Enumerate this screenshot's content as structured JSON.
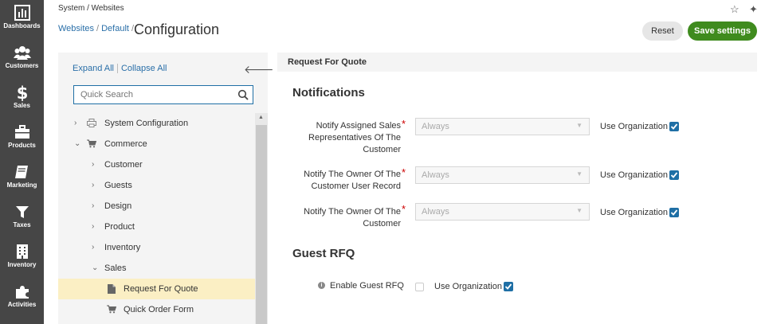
{
  "nav": {
    "items": [
      {
        "label": "Dashboards",
        "icon": "dashboard-icon"
      },
      {
        "label": "Customers",
        "icon": "users-icon"
      },
      {
        "label": "Sales",
        "icon": "dollar-icon"
      },
      {
        "label": "Products",
        "icon": "briefcase-icon"
      },
      {
        "label": "Marketing",
        "icon": "book-icon"
      },
      {
        "label": "Taxes",
        "icon": "filter-icon"
      },
      {
        "label": "Inventory",
        "icon": "building-icon"
      },
      {
        "label": "Activities",
        "icon": "puzzle-icon"
      }
    ]
  },
  "header": {
    "crumb_top": "System / Websites",
    "crumb_websites": "Websites",
    "crumb_sep": "/",
    "crumb_default": "Default",
    "title": "Configuration",
    "star_icon": "☆",
    "pin_icon": "✦",
    "reset_label": "Reset",
    "save_label": "Save settings"
  },
  "tree": {
    "expand_all": "Expand All",
    "collapse_all": "Collapse All",
    "back_arrow": "🡐",
    "search_placeholder": "Quick Search",
    "items": [
      {
        "label": "System Configuration",
        "level": 0,
        "chevron": "›",
        "icon": "printer-icon"
      },
      {
        "label": "Commerce",
        "level": 0,
        "chevron": "⌄",
        "icon": "cart-icon"
      },
      {
        "label": "Customer",
        "level": 1,
        "chevron": "›"
      },
      {
        "label": "Guests",
        "level": 1,
        "chevron": "›"
      },
      {
        "label": "Design",
        "level": 1,
        "chevron": "›"
      },
      {
        "label": "Product",
        "level": 1,
        "chevron": "›"
      },
      {
        "label": "Inventory",
        "level": 1,
        "chevron": "›"
      },
      {
        "label": "Sales",
        "level": 1,
        "chevron": "⌄"
      },
      {
        "label": "Request For Quote",
        "level": 2,
        "icon": "file-icon",
        "selected": true
      },
      {
        "label": "Quick Order Form",
        "level": 2,
        "icon": "cart-icon"
      }
    ]
  },
  "content": {
    "section": "Request For Quote",
    "notifications_title": "Notifications",
    "guest_title": "Guest RFQ",
    "fields": [
      {
        "label_lines": [
          "Notify Assigned Sales",
          "Representatives Of The",
          "Customer"
        ],
        "value": "Always",
        "use_org": "Use Organization",
        "checked": true
      },
      {
        "label_lines": [
          "Notify The Owner Of The",
          "Customer User Record"
        ],
        "value": "Always",
        "use_org": "Use Organization",
        "checked": true
      },
      {
        "label_lines": [
          "Notify The Owner Of The",
          "Customer"
        ],
        "value": "Always",
        "use_org": "Use Organization",
        "checked": true
      }
    ],
    "guest_field": {
      "label": "Enable Guest RFQ",
      "use_org": "Use Organization",
      "checked": false,
      "use_org_checked": true
    }
  },
  "colors": {
    "nav_bg": "#464646",
    "link": "#2a6fa8",
    "save_bg": "#3f8b1e",
    "checkbox": "#1f6fa5",
    "selected_row": "#fbefc4",
    "required": "#cc0000"
  }
}
